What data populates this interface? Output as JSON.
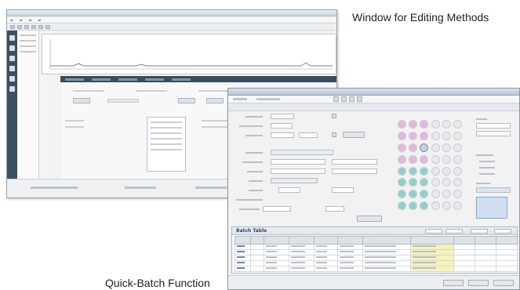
{
  "captions": {
    "editing_methods": "Window for Editing Methods",
    "quick_batch": "Quick-Batch Function"
  },
  "batch_window": {
    "batch_table_title": "Batch Table"
  },
  "colors": {
    "sidebar": "#3d4f63",
    "highlight_column": "#f6f2b8",
    "well_pink": "#e7b6dc",
    "well_teal": "#8fd1c9",
    "well_selected": "#c5cfe0"
  }
}
